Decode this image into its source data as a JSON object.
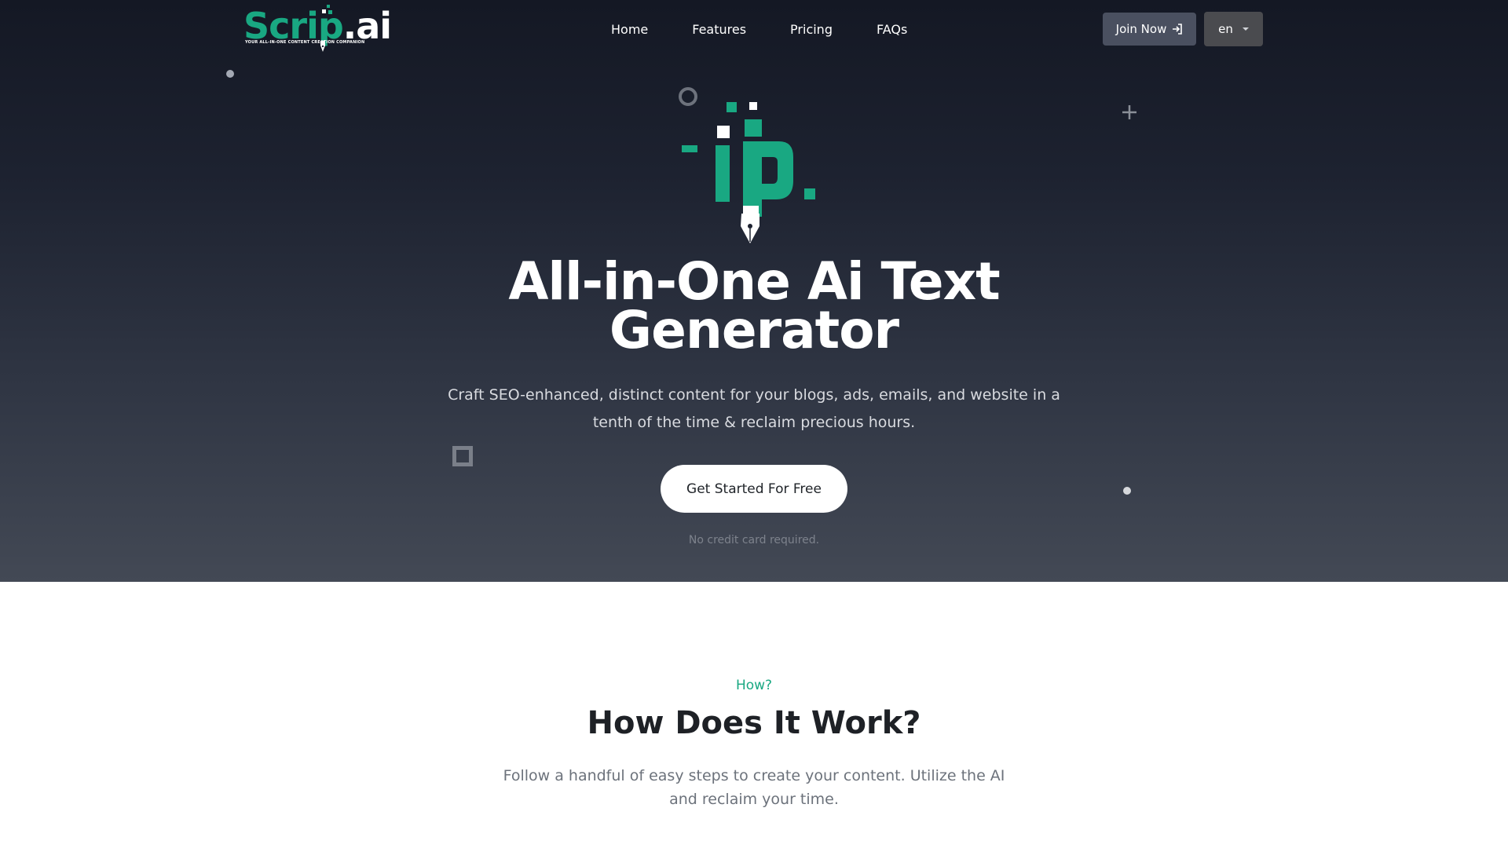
{
  "brand": {
    "name_green": "Scrip",
    "name_white": ".ai",
    "tagline": "YOUR ALL-IN-ONE CONTENT CREATION COMPANION"
  },
  "nav": {
    "links": [
      "Home",
      "Features",
      "Pricing",
      "FAQs"
    ],
    "join_label": "Join Now",
    "language": "en"
  },
  "hero": {
    "title": "All-in-One Ai Text Generator",
    "subtitle": "Craft SEO-enhanced, distinct content for your blogs, ads, emails, and website in a tenth of the time & reclaim precious hours.",
    "cta_label": "Get Started For Free",
    "note": "No credit card required."
  },
  "how": {
    "eyebrow": "How?",
    "title": "How Does It Work?",
    "subtitle": "Follow a handful of easy steps to create your content. Utilize the AI and reclaim your time."
  },
  "colors": {
    "accent": "#19a882",
    "hero_top": "#141824",
    "hero_bottom": "#434955",
    "button_dark": "#4a5060"
  },
  "icons": {
    "join": "sign-in-icon",
    "language": "chevron-down-icon",
    "pen": "fountain-pen-icon"
  }
}
